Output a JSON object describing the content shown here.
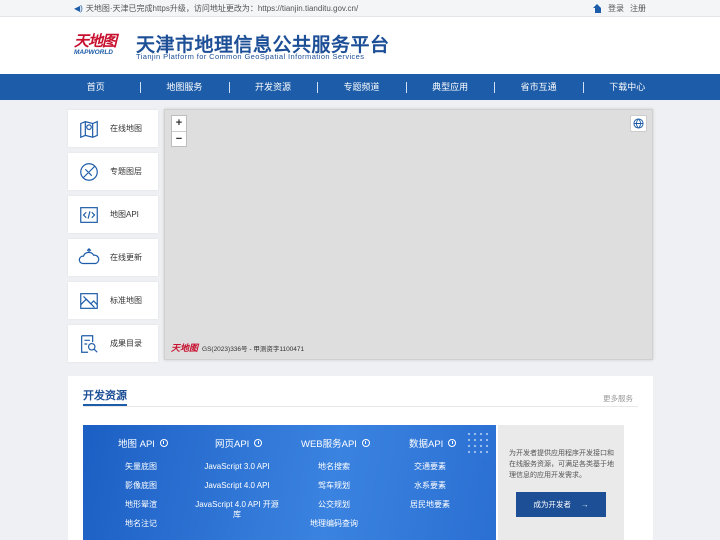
{
  "topbar": {
    "notice": "天地图·天津已完成https升级，访问地址更改为：https://tianjin.tianditu.gov.cn/",
    "login": "登录",
    "logout": "注册"
  },
  "header": {
    "logo_cn": "天地图",
    "logo_en": "MAPWORLD",
    "title_cn": "天津市地理信息公共服务平台",
    "title_en": "Tianjin Platform for Common GeoSpatial Information Services"
  },
  "nav": [
    "首页",
    "地图服务",
    "开发资源",
    "专题频道",
    "典型应用",
    "省市互通",
    "下载中心"
  ],
  "side": [
    {
      "label": "在线地图",
      "icon": "map-pin-icon"
    },
    {
      "label": "专题图层",
      "icon": "layer-compass-icon"
    },
    {
      "label": "地图API",
      "icon": "code-icon"
    },
    {
      "label": "在线更新",
      "icon": "cloud-update-icon"
    },
    {
      "label": "标准地图",
      "icon": "standard-map-icon"
    },
    {
      "label": "成果目录",
      "icon": "catalog-search-icon"
    }
  ],
  "map": {
    "zoom_in": "+",
    "zoom_out": "−",
    "logo": "天地图",
    "approval": "GS(2023)336号 - 甲测资字1100471"
  },
  "dev": {
    "title": "开发资源",
    "more": "更多服务",
    "columns": [
      {
        "head": "地图 API",
        "items": [
          "矢量底图",
          "影像底图",
          "地形晕渲",
          "地名注记"
        ]
      },
      {
        "head": "网页API",
        "items": [
          "JavaScript 3.0 API",
          "JavaScript 4.0 API",
          "JavaScript 4.0 API 开源库"
        ]
      },
      {
        "head": "WEB服务API",
        "items": [
          "地名搜索",
          "驾车规划",
          "公交规划",
          "地理编码查询"
        ]
      },
      {
        "head": "数据API",
        "items": [
          "交通要素",
          "水系要素",
          "居民地要素"
        ]
      }
    ],
    "side_text": "为开发者提供应用程序开发接口和在线服务资源，可满足各类基于地理信息的应用开发需求。",
    "button": "成为开发者",
    "button_arrow": "→"
  }
}
